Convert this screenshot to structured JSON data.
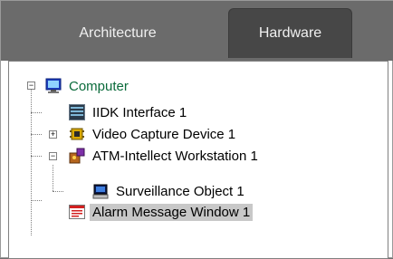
{
  "tabs": [
    {
      "label": "Architecture",
      "active": false
    },
    {
      "label": "Hardware",
      "active": true
    }
  ],
  "tree": {
    "root": {
      "label": "Computer",
      "icon": "monitor-icon",
      "expanded": true
    },
    "children": [
      {
        "label": "IIDK Interface 1",
        "icon": "terminal-icon"
      },
      {
        "label": "Video Capture Device 1",
        "icon": "chip-icon",
        "expandable": true,
        "expanded": false
      },
      {
        "label": "ATM-Intellect Workstation 1",
        "icon": "workstation-icon",
        "expanded": true,
        "children": [
          {
            "label": "Surveillance  Object 1",
            "icon": "pc-icon"
          }
        ]
      },
      {
        "label": "Alarm Message Window 1",
        "icon": "window-icon",
        "selected": true
      }
    ]
  }
}
